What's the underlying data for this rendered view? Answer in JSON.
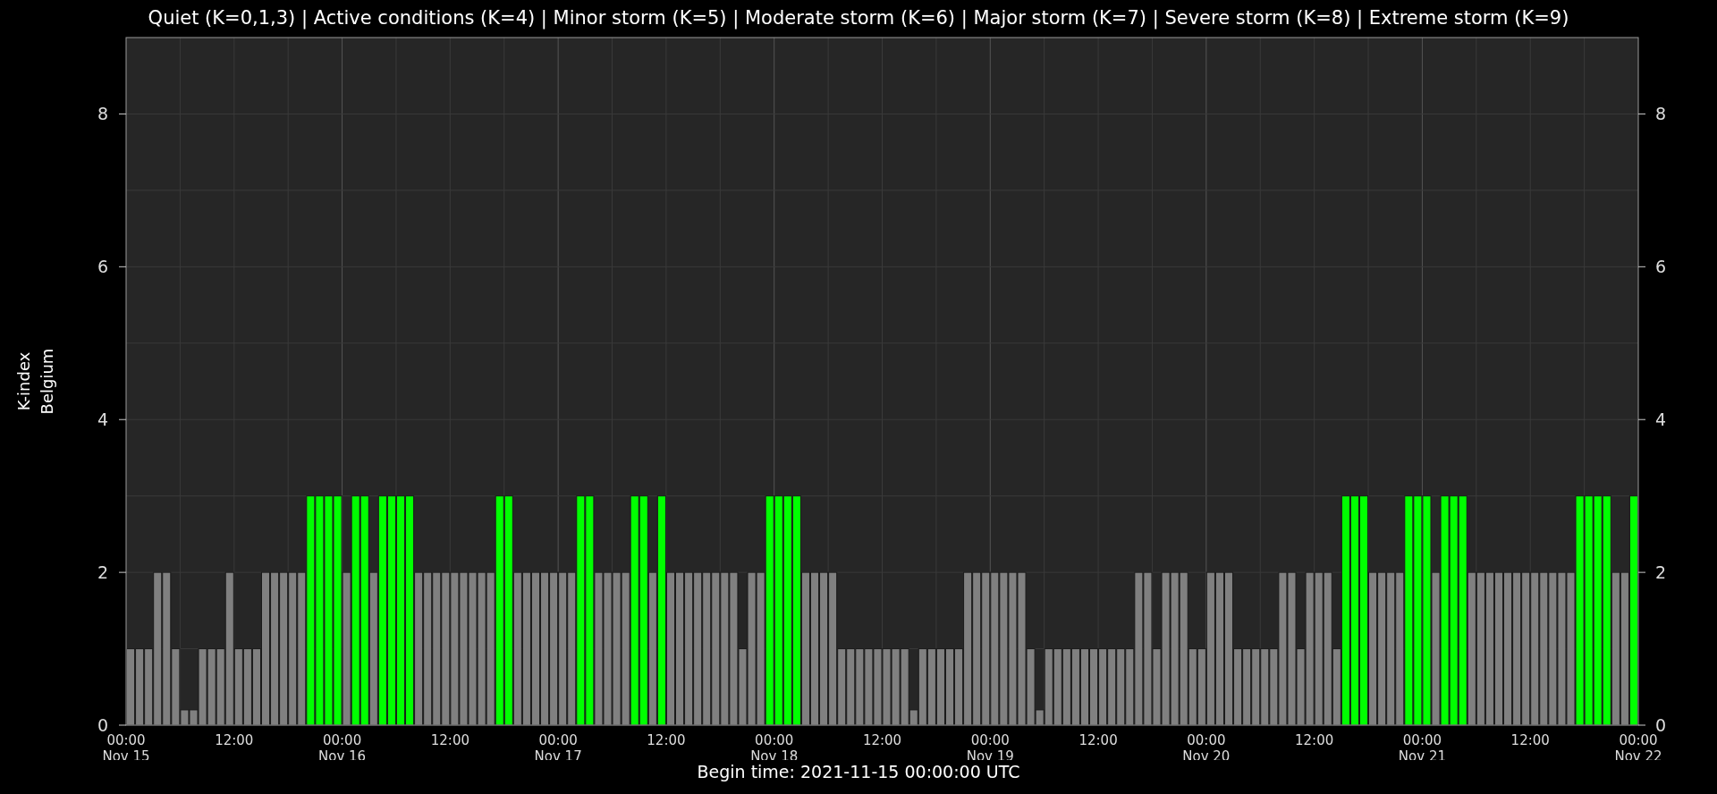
{
  "chart_title": "Quiet (K=0,1,3) | Active conditions (K=4) | Minor storm (K=5) | Moderate storm (K=6) | Major storm (K=7) | Severe storm (K=8) | Extreme storm (K=9)",
  "chart_data": {
    "type": "bar",
    "stacked": true,
    "grid": true,
    "xlabel": "Begin time: 2021-11-15 00:00:00 UTC",
    "ylabel": "K-index",
    "ylim": [
      0,
      9
    ],
    "yticks": [
      0,
      2,
      4,
      6,
      8
    ],
    "series": [
      {
        "color": "#808080",
        "values": [
          1,
          1,
          1,
          2,
          2,
          1,
          0.2,
          0.2,
          1,
          1,
          1,
          2,
          1,
          1,
          1,
          2,
          2,
          2,
          2,
          2,
          null,
          null,
          null,
          null,
          2,
          null,
          null,
          2,
          null,
          null,
          null,
          null,
          2,
          2,
          2,
          2,
          2,
          2,
          2,
          2,
          2,
          null,
          null,
          2,
          2,
          2,
          2,
          2,
          2,
          2,
          null,
          null,
          2,
          2,
          2,
          2,
          null,
          null,
          2,
          null,
          2,
          2,
          2,
          2,
          2,
          2,
          2,
          2,
          1,
          2,
          2,
          null,
          null,
          null,
          null,
          2,
          2,
          2,
          2,
          1,
          1,
          1,
          1,
          1,
          1,
          1,
          1,
          0.2,
          1,
          1,
          1,
          1,
          1,
          2,
          2,
          2,
          2,
          2,
          2,
          2,
          1,
          0.2,
          1,
          1,
          1,
          1,
          1,
          1,
          1,
          1,
          1,
          1,
          2,
          2,
          1,
          2,
          2,
          2,
          1,
          1,
          2,
          2,
          2,
          1,
          1,
          1,
          1,
          1,
          2,
          2,
          1,
          2,
          2,
          2,
          1,
          null,
          null,
          null,
          2,
          2,
          2,
          2,
          null,
          null,
          null,
          2,
          null,
          null,
          null,
          2,
          2,
          2,
          2,
          2,
          2,
          2,
          2,
          2,
          2,
          2,
          2,
          null,
          null,
          null,
          null,
          2,
          2,
          null
        ]
      },
      {
        "color": "#00ff00",
        "values": [
          null,
          null,
          null,
          null,
          null,
          null,
          null,
          null,
          null,
          null,
          null,
          null,
          null,
          null,
          null,
          null,
          null,
          null,
          null,
          null,
          3,
          3,
          3,
          3,
          null,
          3,
          3,
          null,
          3,
          3,
          3,
          3,
          null,
          null,
          null,
          null,
          null,
          null,
          null,
          null,
          null,
          3,
          3,
          null,
          null,
          null,
          null,
          null,
          null,
          null,
          3,
          3,
          null,
          null,
          null,
          null,
          3,
          3,
          null,
          3,
          null,
          null,
          null,
          null,
          null,
          null,
          null,
          null,
          null,
          null,
          null,
          3,
          3,
          3,
          3,
          null,
          null,
          null,
          null,
          null,
          null,
          null,
          null,
          null,
          null,
          null,
          null,
          null,
          null,
          null,
          null,
          null,
          null,
          null,
          null,
          null,
          null,
          null,
          null,
          null,
          null,
          null,
          null,
          null,
          null,
          null,
          null,
          null,
          null,
          null,
          null,
          null,
          null,
          null,
          null,
          null,
          null,
          null,
          null,
          null,
          null,
          null,
          null,
          null,
          null,
          null,
          null,
          null,
          null,
          null,
          null,
          null,
          null,
          null,
          null,
          3,
          3,
          3,
          null,
          null,
          null,
          null,
          3,
          3,
          3,
          null,
          3,
          3,
          3,
          null,
          null,
          null,
          null,
          null,
          null,
          null,
          null,
          null,
          null,
          null,
          null,
          3,
          3,
          3,
          3,
          null,
          null,
          3
        ]
      }
    ]
  },
  "x_tick_labels": [
    {
      "time": "00:00",
      "date": "Nov 15"
    },
    {
      "time": "12:00"
    },
    {
      "time": "00:00",
      "date": "Nov 16"
    },
    {
      "time": "12:00"
    },
    {
      "time": "00:00",
      "date": "Nov 17"
    },
    {
      "time": "12:00"
    },
    {
      "time": "00:00",
      "date": "Nov 18"
    },
    {
      "time": "12:00"
    },
    {
      "time": "00:00",
      "date": "Nov 19"
    },
    {
      "time": "12:00"
    },
    {
      "time": "00:00",
      "date": "Nov 20"
    },
    {
      "time": "12:00"
    },
    {
      "time": "00:00",
      "date": "Nov 21"
    },
    {
      "time": "12:00"
    },
    {
      "time": "00:00",
      "date": "Nov 22"
    }
  ],
  "y_axis_subtitle": "Belgium",
  "right_axis_ticks": [
    "8",
    "6",
    "4",
    "2",
    "0"
  ]
}
